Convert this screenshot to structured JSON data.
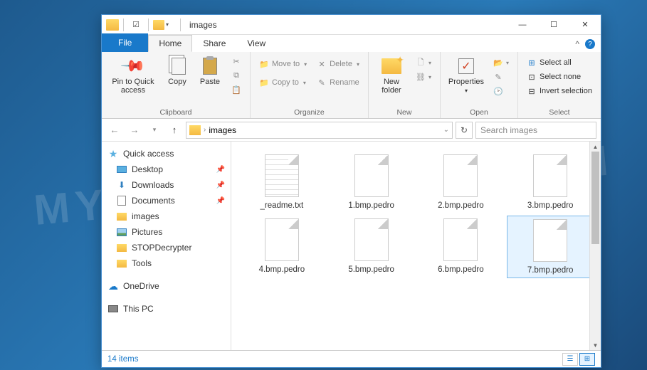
{
  "watermark": "MYANTISPYWARE.COM",
  "window": {
    "title": "images"
  },
  "ribbon": {
    "tabs": {
      "file": "File",
      "home": "Home",
      "share": "Share",
      "view": "View"
    },
    "collapse_caret": "^",
    "clipboard": {
      "label": "Clipboard",
      "pin": "Pin to Quick access",
      "copy": "Copy",
      "paste": "Paste",
      "cut_icon": "cut",
      "copypath_icon": "copy-path",
      "shortcut_icon": "paste-shortcut"
    },
    "organize": {
      "label": "Organize",
      "moveto": "Move to",
      "copyto": "Copy to",
      "delete": "Delete",
      "rename": "Rename"
    },
    "new": {
      "label": "New",
      "newfolder": "New folder",
      "newitem_icon": "new-item",
      "easyaccess_icon": "easy-access"
    },
    "open": {
      "label": "Open",
      "properties": "Properties",
      "open_icon": "open",
      "edit_icon": "edit",
      "history_icon": "history"
    },
    "select": {
      "label": "Select",
      "all": "Select all",
      "none": "Select none",
      "invert": "Invert selection"
    }
  },
  "nav": {
    "breadcrumb": "images",
    "search_placeholder": "Search images"
  },
  "sidebar": {
    "quick": "Quick access",
    "desktop": "Desktop",
    "downloads": "Downloads",
    "documents": "Documents",
    "images": "images",
    "pictures": "Pictures",
    "stop": "STOPDecrypter",
    "tools": "Tools",
    "onedrive": "OneDrive",
    "thispc": "This PC"
  },
  "files": [
    {
      "name": "_readme.txt",
      "type": "txt"
    },
    {
      "name": "1.bmp.pedro",
      "type": "blank"
    },
    {
      "name": "2.bmp.pedro",
      "type": "blank"
    },
    {
      "name": "3.bmp.pedro",
      "type": "blank"
    },
    {
      "name": "4.bmp.pedro",
      "type": "blank"
    },
    {
      "name": "5.bmp.pedro",
      "type": "blank"
    },
    {
      "name": "6.bmp.pedro",
      "type": "blank"
    },
    {
      "name": "7.bmp.pedro",
      "type": "blank",
      "selected": true
    }
  ],
  "status": {
    "count": "14 items"
  }
}
